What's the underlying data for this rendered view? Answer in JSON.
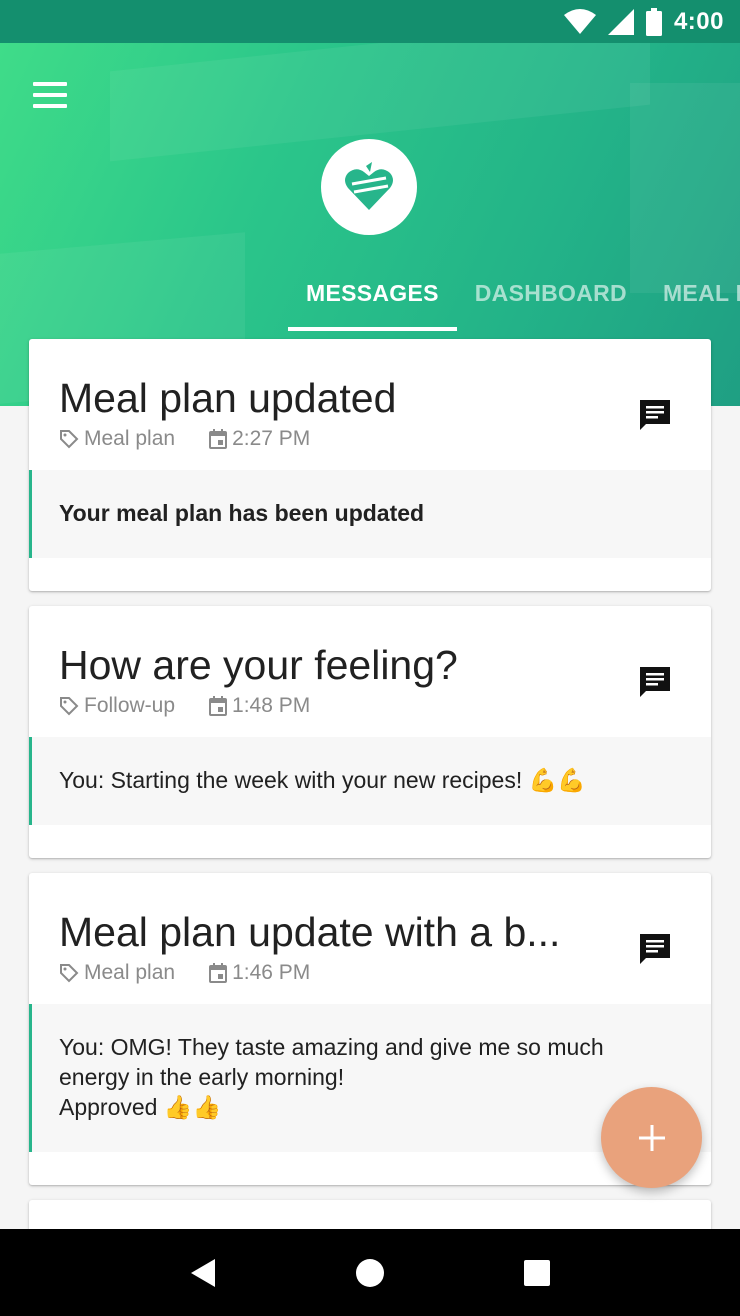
{
  "status_bar": {
    "time": "4:00"
  },
  "tabs": [
    {
      "label": "MESSAGES",
      "active": true
    },
    {
      "label": "DASHBOARD",
      "active": false
    },
    {
      "label": "MEAL P",
      "active": false
    }
  ],
  "messages": [
    {
      "title": "Meal plan updated",
      "category": "Meal plan",
      "time": "2:27 PM",
      "preview": "Your meal plan has been updated",
      "preview_bold": true
    },
    {
      "title": "How are your feeling?",
      "category": "Follow-up",
      "time": "1:48 PM",
      "preview": "You: Starting the week with your new recipes! 💪💪",
      "preview_bold": false
    },
    {
      "title": "Meal plan update with a b...",
      "category": "Meal plan",
      "time": "1:46 PM",
      "preview_lines": [
        "You: OMG! They taste amazing and give me so much",
        "energy in the early morning!",
        "Approved 👍👍"
      ],
      "preview_bold": false
    }
  ],
  "colors": {
    "accent": "#27b58b",
    "status_bar": "#148f6e",
    "fab": "#e9a27c"
  },
  "icons": {
    "menu": "menu-icon",
    "logo": "heart-logo-icon",
    "category": "tag-icon",
    "time": "calendar-icon",
    "chat": "chat-icon",
    "fab": "plus-icon"
  }
}
